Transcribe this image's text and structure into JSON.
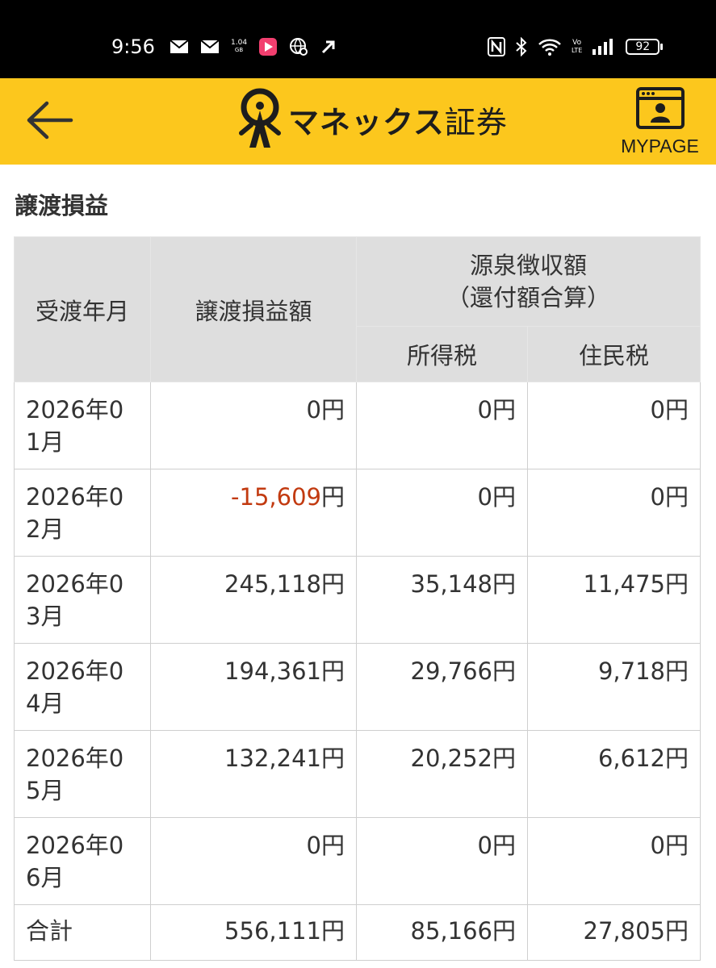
{
  "status_bar": {
    "time": "9:56",
    "net_speed_top": "1.04",
    "net_speed_unit": "GB",
    "volte_top": "Vo",
    "volte_bottom": "LTE",
    "battery": "92"
  },
  "header": {
    "brand": "マネックス",
    "brand_suffix": "証券",
    "mypage_label": "MYPAGE",
    "brand_color": "#fcc71d"
  },
  "page": {
    "title": "譲渡損益"
  },
  "table": {
    "headers": {
      "month": "受渡年月",
      "pl_amount": "譲渡損益額",
      "withholding_line1": "源泉徴収額",
      "withholding_line2": "（還付額合算）",
      "income_tax": "所得税",
      "resident_tax": "住民税"
    },
    "unit": "円",
    "rows": [
      {
        "month_line1": "2026年0",
        "month_line2": "1月",
        "pl": "0",
        "income_tax": "0",
        "resident_tax": "0"
      },
      {
        "month_line1": "2026年0",
        "month_line2": "2月",
        "pl": "-15,609",
        "income_tax": "0",
        "resident_tax": "0"
      },
      {
        "month_line1": "2026年0",
        "month_line2": "3月",
        "pl": "245,118",
        "income_tax": "35,148",
        "resident_tax": "11,475"
      },
      {
        "month_line1": "2026年0",
        "month_line2": "4月",
        "pl": "194,361",
        "income_tax": "29,766",
        "resident_tax": "9,718"
      },
      {
        "month_line1": "2026年0",
        "month_line2": "5月",
        "pl": "132,241",
        "income_tax": "20,252",
        "resident_tax": "6,612"
      },
      {
        "month_line1": "2026年0",
        "month_line2": "6月",
        "pl": "0",
        "income_tax": "0",
        "resident_tax": "0"
      }
    ],
    "total": {
      "label": "合計",
      "pl": "556,111",
      "income_tax": "85,166",
      "resident_tax": "27,805"
    },
    "negative_color": "#c23a10"
  }
}
